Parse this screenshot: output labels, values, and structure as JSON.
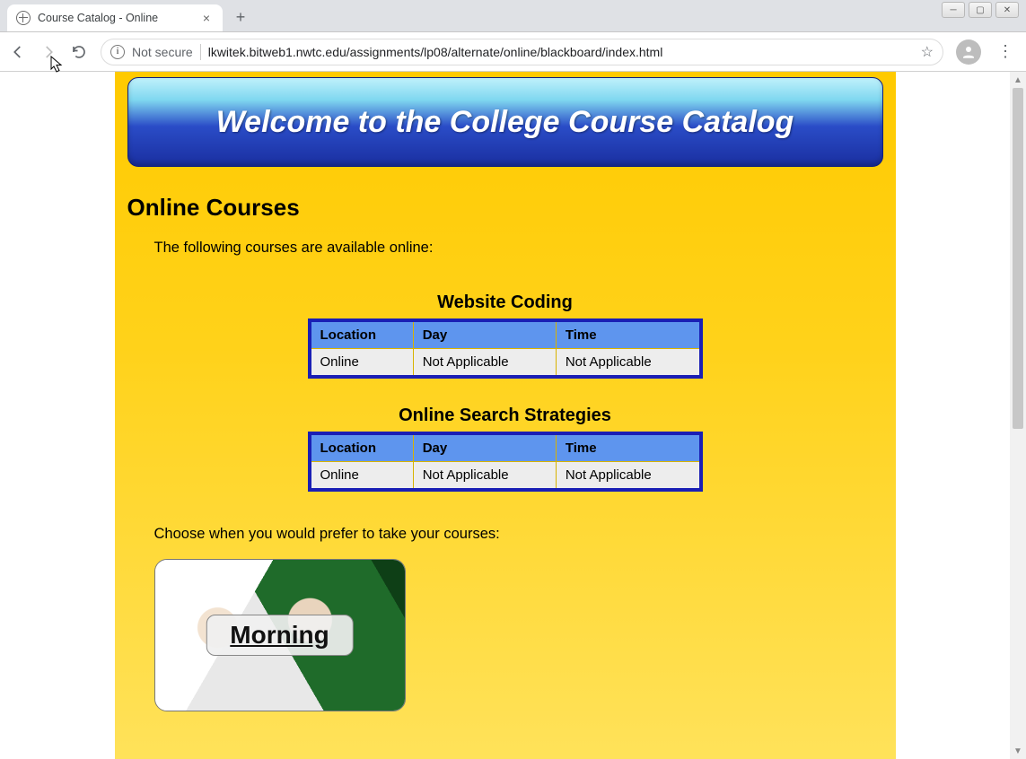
{
  "browser": {
    "tab_title": "Course Catalog - Online",
    "security_label": "Not secure",
    "url": "lkwitek.bitweb1.nwtc.edu/assignments/lp08/alternate/online/blackboard/index.html"
  },
  "page": {
    "banner_title": "Welcome to the College Course Catalog",
    "section_heading": "Online Courses",
    "intro_text": "The following courses are available online:",
    "choose_text": "Choose when you would prefer to take your courses:",
    "courses": [
      {
        "caption": "Website Coding",
        "headers": {
          "location": "Location",
          "day": "Day",
          "time": "Time"
        },
        "row": {
          "location": "Online",
          "day": "Not Applicable",
          "time": "Not Applicable"
        }
      },
      {
        "caption": "Online Search Strategies",
        "headers": {
          "location": "Location",
          "day": "Day",
          "time": "Time"
        },
        "row": {
          "location": "Online",
          "day": "Not Applicable",
          "time": "Not Applicable"
        }
      }
    ],
    "time_option_label": "Morning"
  }
}
